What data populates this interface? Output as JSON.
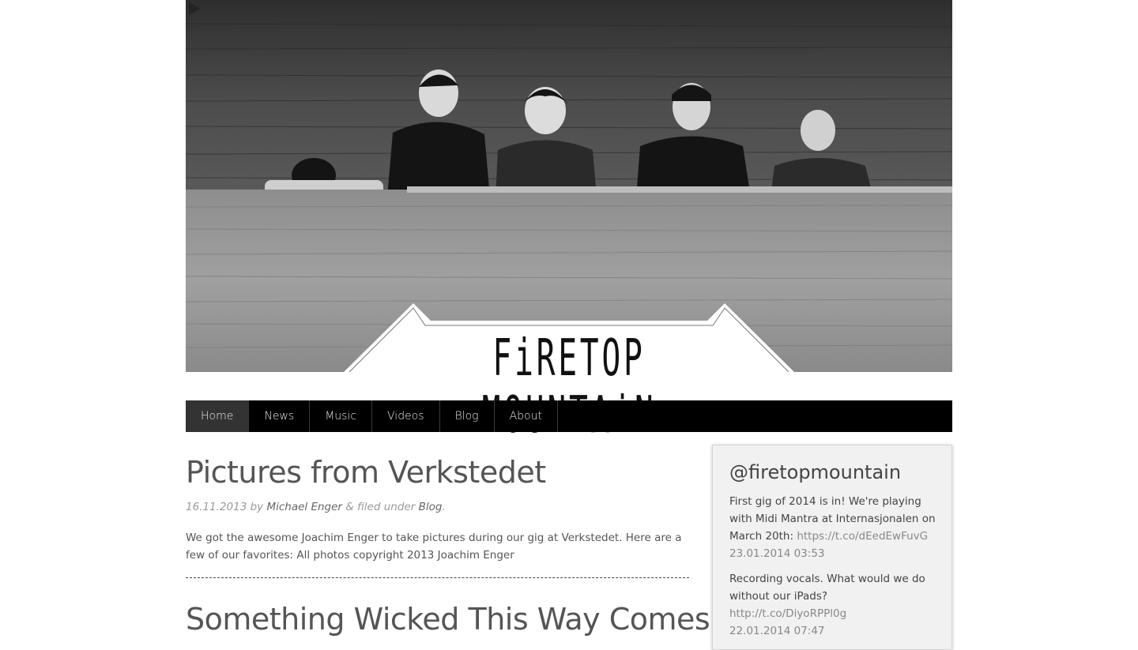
{
  "header": {
    "logo_text": "FiRETOP MOUNTAiN"
  },
  "nav": {
    "items": [
      {
        "label": "Home",
        "active": true
      },
      {
        "label": "News"
      },
      {
        "label": "Music"
      },
      {
        "label": "Videos"
      },
      {
        "label": "Blog"
      },
      {
        "label": "About"
      }
    ]
  },
  "post": {
    "title": "Pictures from Verkstedet",
    "date": "16.11.2013",
    "by": "by",
    "author": "Michael Enger",
    "filed": "& filed under",
    "category": "Blog",
    "period": ".",
    "body": "We got the awesome Joachim Enger to take pictures during our gig at Verkstedet. Here are a few of our favorites: All photos copyright 2013 Joachim Enger"
  },
  "next_post": {
    "title": "Something Wicked This Way Comes"
  },
  "sidebar": {
    "title": "@firetopmountain",
    "tweets": [
      {
        "text": "First gig of 2014 is in! We're playing with Midi Mantra at Internasjonalen on March 20th:",
        "link": "https://t.co/dEedEwFuvG",
        "date": "23.01.2014 03:53"
      },
      {
        "text": "Recording vocals. What would we do without our iPads?",
        "link": "http://t.co/DiyoRPPl0g",
        "date": "22.01.2014 07:47"
      }
    ]
  },
  "colors": {
    "nav_bg": "#000000",
    "nav_active": "#333333",
    "sidebar_bg": "#f1f1f1",
    "title_color": "#555555"
  }
}
